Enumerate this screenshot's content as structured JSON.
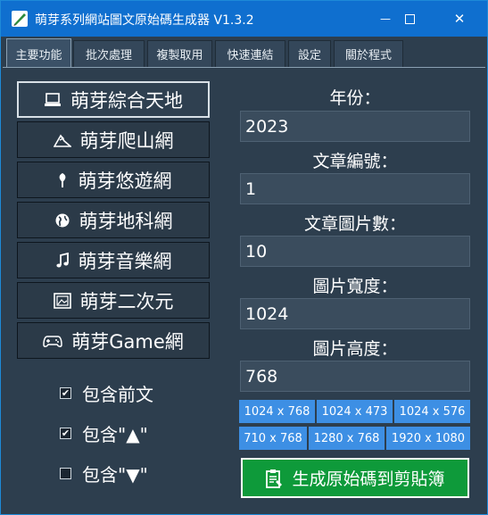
{
  "window": {
    "title": "萌芽系列網站圖文原始碼生成器 V1.3.2",
    "minimize_glyph": "—",
    "close_glyph": "✕"
  },
  "tabs": [
    {
      "label": "主要功能",
      "active": true
    },
    {
      "label": "批次處理"
    },
    {
      "label": "複製取用"
    },
    {
      "label": "快速連結"
    },
    {
      "label": "設定"
    },
    {
      "label": "關於程式"
    }
  ],
  "sites": [
    {
      "label": "萌芽綜合天地",
      "icon": "laptop-icon"
    },
    {
      "label": "萌芽爬山網",
      "icon": "mountain-icon"
    },
    {
      "label": "萌芽悠遊網",
      "icon": "tree-icon"
    },
    {
      "label": "萌芽地科網",
      "icon": "globe-icon"
    },
    {
      "label": "萌芽音樂網",
      "icon": "music-note-icon"
    },
    {
      "label": "萌芽二次元",
      "icon": "picture-frame-icon"
    },
    {
      "label": "萌芽Game網",
      "icon": "gamepad-icon"
    }
  ],
  "options": [
    {
      "label": "包含前文",
      "checked": true,
      "mark": "✔"
    },
    {
      "label": "包含\"▲\"",
      "checked": true,
      "mark": "✔"
    },
    {
      "label": "包含\"▼\"",
      "checked": false,
      "mark": ""
    }
  ],
  "form": {
    "year_label": "年份：",
    "year_value": "2023",
    "article_no_label": "文章編號：",
    "article_no_value": "1",
    "image_count_label": "文章圖片數：",
    "image_count_value": "10",
    "image_width_label": "圖片寬度：",
    "image_width_value": "1024",
    "image_height_label": "圖片高度：",
    "image_height_value": "768"
  },
  "presets": [
    "1024 x 768",
    "1024 x 473",
    "1024 x 576",
    "710 x 768",
    "1280 x 768",
    "1920 x 1080"
  ],
  "generate_label": "生成原始碼到剪貼簿",
  "colors": {
    "titlebar": "#0f6fcf",
    "background": "#2d3e4e",
    "preset": "#3d8fe4",
    "generate": "#0e9a3a"
  }
}
